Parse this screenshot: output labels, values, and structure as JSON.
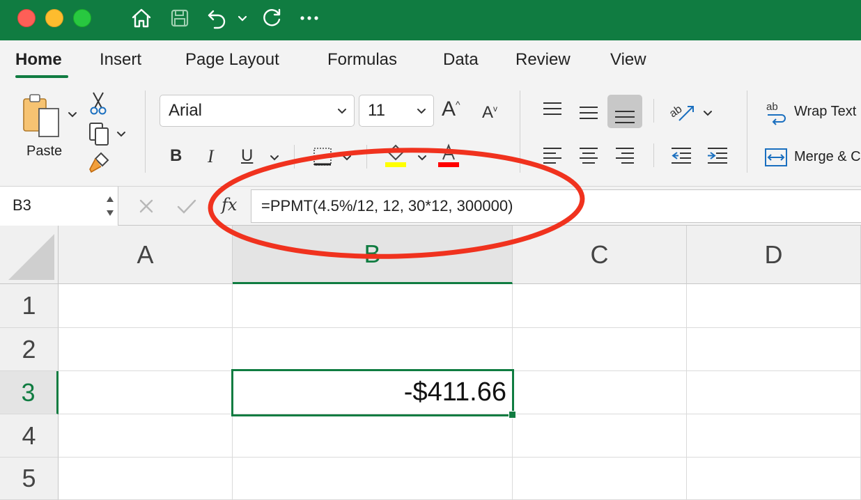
{
  "colors": {
    "accent": "#107c41",
    "annotation": "#f0321e"
  },
  "titlebar": {
    "icons": [
      "home-icon",
      "save-icon",
      "undo-icon",
      "chevron-down-icon",
      "redo-icon",
      "more-icon"
    ]
  },
  "tabs": [
    {
      "label": "Home",
      "active": true
    },
    {
      "label": "Insert"
    },
    {
      "label": "Page Layout"
    },
    {
      "label": "Formulas"
    },
    {
      "label": "Data"
    },
    {
      "label": "Review"
    },
    {
      "label": "View"
    }
  ],
  "ribbon": {
    "paste_label": "Paste",
    "font_name": "Arial",
    "font_size": "11",
    "bold": "B",
    "italic": "I",
    "underline": "U",
    "increase_font": "A",
    "decrease_font": "A",
    "font_color_letter": "A",
    "wrap_icon_text": "ab",
    "wrap_label": "Wrap Text",
    "merge_label": "Merge & Center"
  },
  "formula_bar": {
    "name_box": "B3",
    "fx_label": "fx",
    "formula": "=PPMT(4.5%/12, 12, 30*12, 300000)"
  },
  "grid": {
    "columns": [
      "A",
      "B",
      "C",
      "D"
    ],
    "rows": [
      "1",
      "2",
      "3",
      "4",
      "5"
    ],
    "selected_column": "B",
    "selected_row": "3",
    "active_cell_value": "-$411.66"
  }
}
